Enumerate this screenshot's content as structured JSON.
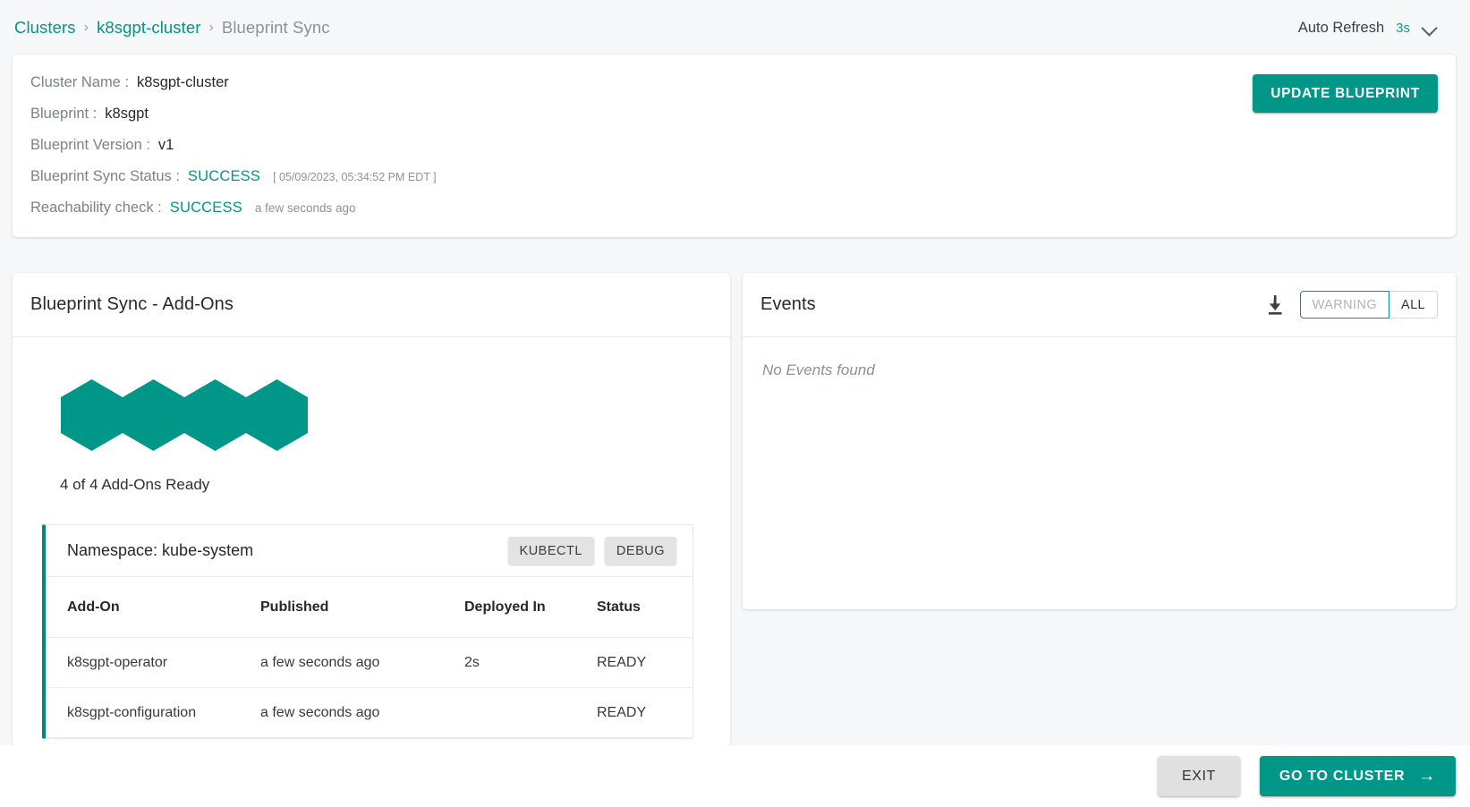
{
  "breadcrumb": {
    "root": "Clusters",
    "separator": "›",
    "cluster": "k8sgpt-cluster",
    "current": "Blueprint Sync"
  },
  "header": {
    "auto_refresh_label": "Auto Refresh",
    "auto_refresh_value": "3s",
    "chevron_icon": "chevron-down-icon"
  },
  "cluster_info": {
    "cluster_name_label": "Cluster Name :",
    "cluster_name_value": "k8sgpt-cluster",
    "blueprint_label": "Blueprint :",
    "blueprint_value": "k8sgpt",
    "blueprint_version_label": "Blueprint Version :",
    "blueprint_version_value": "v1",
    "sync_status_label": "Blueprint Sync Status :",
    "sync_status_value": "SUCCESS",
    "sync_status_time": "[ 05/09/2023, 05:34:52 PM EDT ]",
    "reachability_label": "Reachability check :",
    "reachability_value": "SUCCESS",
    "reachability_time": "a few seconds ago",
    "update_button": "UPDATE BLUEPRINT"
  },
  "addons_panel": {
    "title": "Blueprint Sync - Add-Ons",
    "hexagon_count": 4,
    "ready_summary": "4 of 4 Add-Ons Ready",
    "namespace_title": "Namespace: kube-system",
    "kubectl_button": "KUBECTL",
    "debug_button": "DEBUG",
    "columns": [
      "Add-On",
      "Published",
      "Deployed In",
      "Status"
    ],
    "rows": [
      {
        "addon": "k8sgpt-operator",
        "published": "a few seconds ago",
        "deployed_in": "2s",
        "status": "READY"
      },
      {
        "addon": "k8sgpt-configuration",
        "published": "a few seconds ago",
        "deployed_in": "",
        "status": "READY"
      }
    ]
  },
  "events_panel": {
    "title": "Events",
    "download_icon": "download-icon",
    "filter_warning": "WARNING",
    "filter_all": "ALL",
    "empty_message": "No Events found"
  },
  "footer": {
    "exit_button": "EXIT",
    "goto_button": "GO TO CLUSTER",
    "goto_arrow": "→"
  },
  "colors": {
    "accent": "#009688",
    "page_bg": "#f6f7f9",
    "panel_bg": "#ffffff",
    "muted_text": "#8b9197"
  }
}
